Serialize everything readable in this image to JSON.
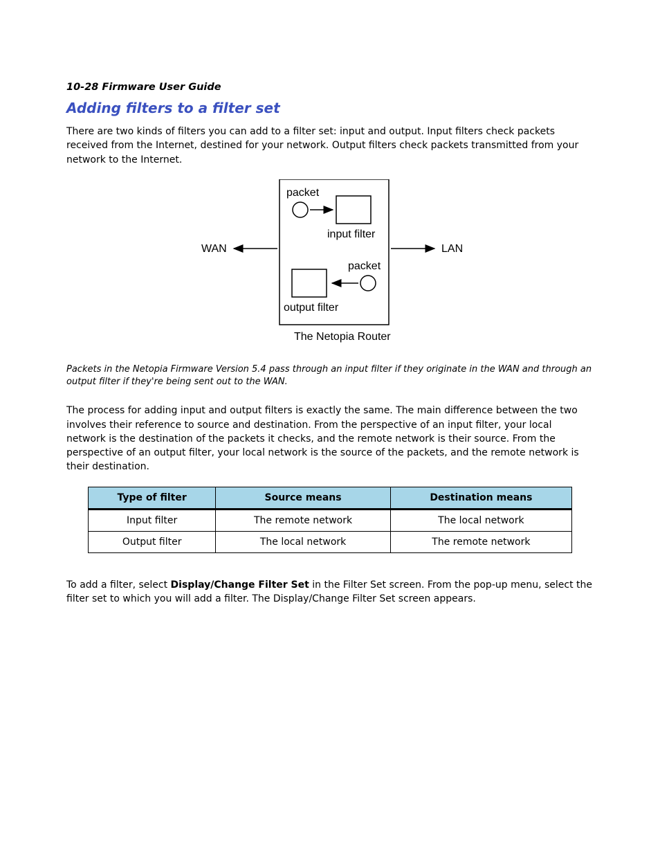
{
  "header": {
    "page_ref": "10-28  Firmware User Guide"
  },
  "section": {
    "title": "Adding filters to a filter set"
  },
  "para1": "There are two kinds of filters you can add to a filter set: input and output. Input filters check packets received from the Internet, destined for your network. Output filters check packets transmitted from your network to the Internet.",
  "diagram": {
    "packet_top": "packet",
    "input_filter": "input filter",
    "wan": "WAN",
    "lan": "LAN",
    "packet_bottom": "packet",
    "output_filter": "output filter",
    "device_name": "The Netopia Router"
  },
  "caption": "Packets in the Netopia Firmware Version 5.4 pass through an input filter if they originate in the WAN and through an output filter if they're being sent out to the WAN.",
  "para2": "The process for adding input and output filters is exactly the same. The main difference between the two involves their reference to source and destination. From the perspective of an input filter, your local network is the destination of the packets it checks, and the remote network is their source. From the perspective of an output filter, your local network is the source of the packets, and the remote network is their destination.",
  "table": {
    "headers": {
      "c1": "Type of filter",
      "c2": "Source means",
      "c3": "Destination means"
    },
    "rows": [
      {
        "c1": "Input filter",
        "c2": "The remote network",
        "c3": "The local network"
      },
      {
        "c1": "Output filter",
        "c2": "The local network",
        "c3": "The remote network"
      }
    ]
  },
  "para3": {
    "a": "To add a filter, select ",
    "b": "Display/Change Filter Set",
    "c": " in the Filter Set screen. From the pop-up menu, select the filter set to which you will add a filter. The Display/Change Filter Set screen appears."
  }
}
